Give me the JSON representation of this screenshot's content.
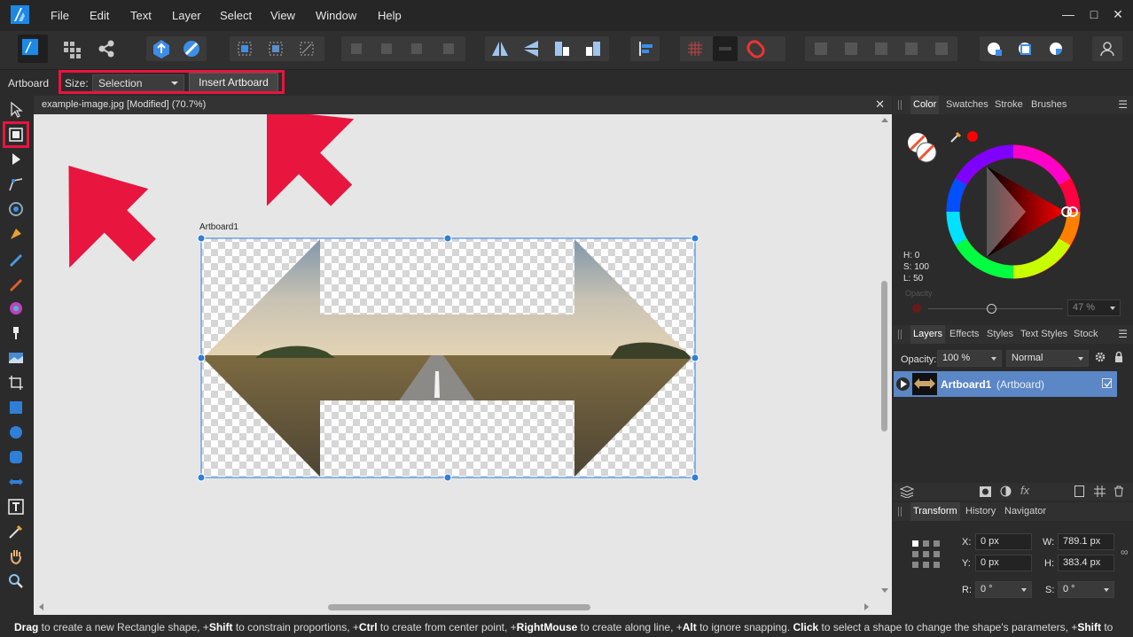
{
  "menu": {
    "items": [
      "File",
      "Edit",
      "Text",
      "Layer",
      "Select",
      "View",
      "Window",
      "Help"
    ]
  },
  "context_bar": {
    "tool_name": "Artboard",
    "size_label": "Size:",
    "size_value": "Selection",
    "insert_button": "Insert Artboard"
  },
  "document": {
    "tab_title": "example-image.jpg [Modified] (70.7%)",
    "artboard_label": "Artboard1"
  },
  "color_panel": {
    "tabs": [
      "Color",
      "Swatches",
      "Stroke",
      "Brushes"
    ],
    "active_tab": "Color",
    "h": "H: 0",
    "s": "S: 100",
    "l": "L: 50",
    "opacity_label": "Opacity",
    "opacity_value": "47 %",
    "current_color": "#ff0000"
  },
  "layers_panel": {
    "tabs": [
      "Layers",
      "Effects",
      "Styles",
      "Text Styles",
      "Stock"
    ],
    "active_tab": "Layers",
    "opacity_label": "Opacity:",
    "opacity_value": "100 %",
    "blend_mode": "Normal",
    "layers": [
      {
        "name": "Artboard1",
        "type": "(Artboard)"
      }
    ]
  },
  "transform_panel": {
    "tabs": [
      "Transform",
      "History",
      "Navigator"
    ],
    "active_tab": "Transform",
    "x_label": "X:",
    "x_value": "0 px",
    "y_label": "Y:",
    "y_value": "0 px",
    "w_label": "W:",
    "w_value": "789.1 px",
    "h_label": "H:",
    "h_value": "383.4 px",
    "r_label": "R:",
    "r_value": "0 °",
    "s_label": "S:",
    "s_value": "0 °"
  },
  "status": {
    "segments": [
      {
        "b": "Drag",
        "t": " to create a new Rectangle shape, +"
      },
      {
        "b": "Shift",
        "t": " to constrain proportions, +"
      },
      {
        "b": "Ctrl",
        "t": " to create from center point, +"
      },
      {
        "b": "RightMouse",
        "t": " to create along line, +"
      },
      {
        "b": "Alt",
        "t": " to ignore snapping. "
      },
      {
        "b": "Click",
        "t": " to select a shape to change the shape's parameters, +"
      },
      {
        "b": "Shift",
        "t": " to"
      }
    ]
  },
  "colors": {
    "accent_blue": "#2f7fd8",
    "highlight_red": "#e8153e",
    "selected_layer": "#5b87c6"
  }
}
